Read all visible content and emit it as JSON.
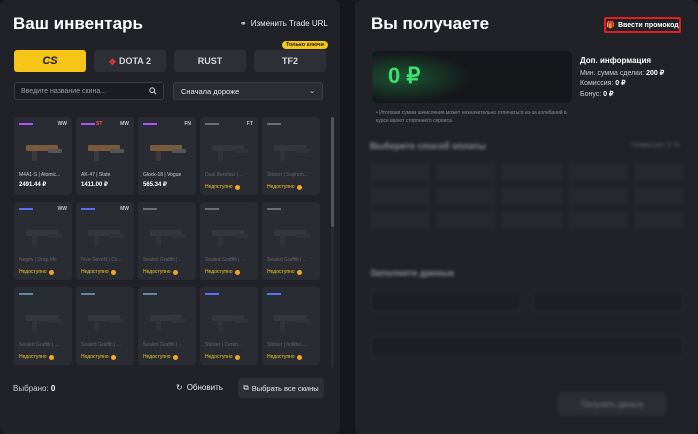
{
  "inventory": {
    "title": "Ваш инвентарь",
    "trade_url_label": "Изменить Trade URL",
    "games": [
      {
        "label": "CS",
        "active": true
      },
      {
        "label": "DOTA 2",
        "active": false
      },
      {
        "label": "RUST",
        "active": false
      },
      {
        "label": "TF2",
        "active": false,
        "badge": "Только ключи"
      }
    ],
    "search_placeholder": "Введите название скина...",
    "sort_label": "Сначала дороже",
    "selected_label": "Выбрано:",
    "selected_count": "0",
    "refresh_label": "Обновить",
    "select_all_label": "Выбрать все скины",
    "items": [
      {
        "name": "M4A1-S | Atomic...",
        "price": "2491.44 ₽",
        "exterior": "WW",
        "line": "#a855f7",
        "tag": ""
      },
      {
        "name": "AK-47 | Slate",
        "price": "1411.00 ₽",
        "exterior": "MW",
        "line": "#a855f7",
        "tag": "ST"
      },
      {
        "name": "Glock-18 | Vogue",
        "price": "565.34 ₽",
        "exterior": "FN",
        "line": "#a855f7",
        "tag": ""
      },
      {
        "name": "Dual Berettas | ...",
        "status": "Недоступно",
        "exterior": "FT",
        "line": "#6b6e76",
        "tag": ""
      },
      {
        "name": "Sticker | Suprem...",
        "status": "Недоступно",
        "exterior": "",
        "line": "#6b6e76",
        "tag": ""
      },
      {
        "name": "Negev | Drop Me",
        "status": "Недоступно",
        "exterior": "WW",
        "line": "#5b6ef5",
        "tag": ""
      },
      {
        "name": "Five-SeveN | Co...",
        "status": "Недоступно",
        "exterior": "MW",
        "line": "#5b6ef5",
        "tag": ""
      },
      {
        "name": "Sealed Graffiti | ...",
        "status": "Недоступно",
        "exterior": "",
        "line": "#6b6e76",
        "tag": ""
      },
      {
        "name": "Sealed Graffiti | ...",
        "status": "Недоступно",
        "exterior": "",
        "line": "#6b6e76",
        "tag": ""
      },
      {
        "name": "Sealed Graffiti | ...",
        "status": "Недоступно",
        "exterior": "",
        "line": "#6b6e76",
        "tag": ""
      },
      {
        "name": "Sealed Graffiti | ...",
        "status": "Недоступно",
        "exterior": "",
        "line": "#5b8a9a",
        "tag": ""
      },
      {
        "name": "Sealed Graffiti | ...",
        "status": "Недоступно",
        "exterior": "",
        "line": "#5b8a9a",
        "tag": ""
      },
      {
        "name": "Sealed Graffiti | ...",
        "status": "Недоступно",
        "exterior": "",
        "line": "#5b8a9a",
        "tag": ""
      },
      {
        "name": "Sticker | Centri...",
        "status": "Недоступно",
        "exterior": "",
        "line": "#5b6ef5",
        "tag": ""
      },
      {
        "name": "Sticker | huNter-...",
        "status": "Недоступно",
        "exterior": "",
        "line": "#5b6ef5",
        "tag": ""
      }
    ]
  },
  "receive": {
    "title": "Вы получаете",
    "promo_label": "Ввести промокод",
    "amount": "0 ₽",
    "info_title": "Доп. информация",
    "min_sum_label": "Мин. сумма сделки:",
    "min_sum_value": "200 ₽",
    "commission_label": "Комиссия:",
    "commission_value": "0 ₽",
    "bonus_label": "Бонус:",
    "bonus_value": "0 ₽",
    "note": "• Итоговая сумма зачисления может незначительно отличаться из-за колебаний в курсе валют стороннего сервиса.",
    "payment_title": "Выберите способ оплаты",
    "payment_commission": "Комиссия: 0 %",
    "fill_title": "Заполните данные",
    "get_button": "Получить деньги"
  },
  "colors": {
    "accent": "#f5c518",
    "amount": "#3de06d",
    "promo_border": "#e61e1e"
  }
}
